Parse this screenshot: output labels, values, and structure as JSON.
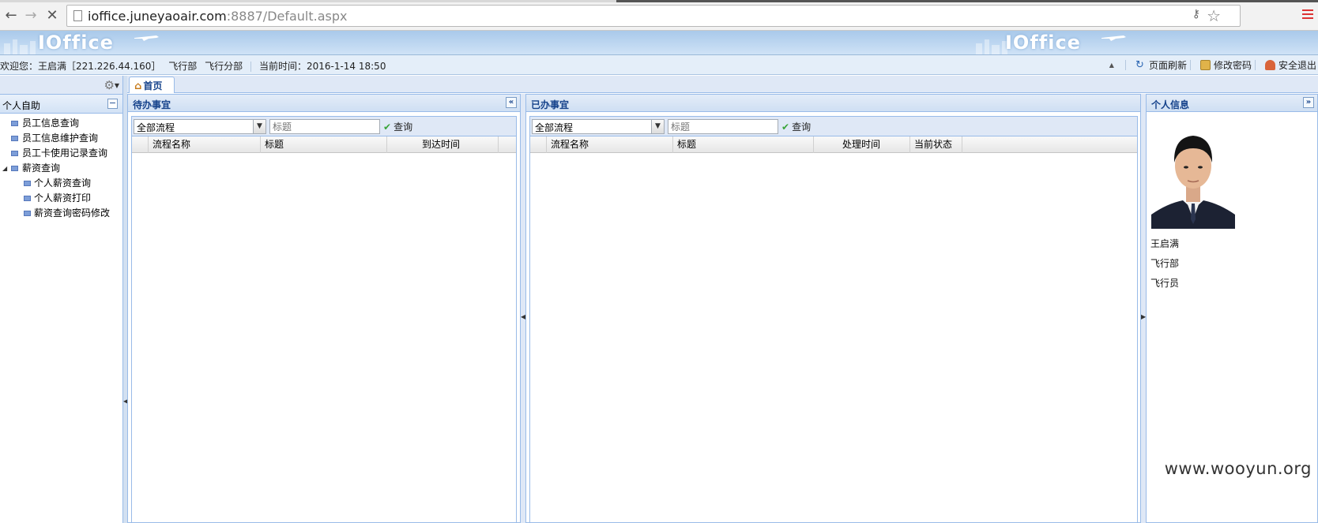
{
  "browser": {
    "url_host": "ioffice.juneyaoair.com",
    "url_rest": ":8887/Default.aspx"
  },
  "banner": {
    "logo": "IOffice"
  },
  "infobar": {
    "welcome": "欢迎您：王启满［221.226.44.160］",
    "dept": "飞行部",
    "subdept": "飞行分部",
    "time_label": "当前时间：2016-1-14 18:50",
    "refresh": "页面刷新",
    "change_password": "修改密码",
    "logout": "安全退出"
  },
  "sidebar": {
    "section": "个人自助",
    "items": [
      {
        "label": "员工信息查询"
      },
      {
        "label": "员工信息维护查询"
      },
      {
        "label": "员工卡使用记录查询"
      },
      {
        "label": "薪资查询"
      },
      {
        "label": "个人薪资查询"
      },
      {
        "label": "个人薪资打印"
      },
      {
        "label": "薪资查询密码修改"
      }
    ]
  },
  "tabs": {
    "home": "首页"
  },
  "pending": {
    "title": "待办事宜",
    "filter": "全部流程",
    "placeholder": "标题",
    "query": "查询",
    "columns": [
      "流程名称",
      "标题",
      "到达时间"
    ]
  },
  "done": {
    "title": "已办事宜",
    "filter": "全部流程",
    "placeholder": "标题",
    "query": "查询",
    "columns": [
      "流程名称",
      "标题",
      "处理时间",
      "当前状态"
    ]
  },
  "profile": {
    "title": "个人信息",
    "name": "王启满",
    "dept": "飞行部",
    "position": "飞行员"
  },
  "watermark": "www.wooyun.org",
  "colors": {
    "accent": "#15428b",
    "panel_border": "#99bbe8"
  }
}
